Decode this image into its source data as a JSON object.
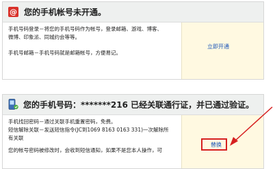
{
  "panel_activate": {
    "title": "您的手机帐号未开通。",
    "lines": [
      "手机号码登录－将您的手机号码作为帐号，登录邮箱、游戏、博客、",
      "微博、印象派、同城约会等等。",
      "手机号邮箱－手机号码就是邮箱帐号，方便易记。"
    ],
    "action_label": "立即开通"
  },
  "panel_bound": {
    "title": "您的手机号码：*******216  已经关联通行证，并已通过验证。",
    "lines": [
      "手机找回密码－通过关联手机重置密码，免费。",
      "短信解除关联－发送短信指令(JC到1069 8163 0163 331)一次解除所",
      "有关联",
      "您的帐号密码被修改时，会收到短信通知，如果不是您本人操作，可"
    ],
    "action_label": "替换"
  },
  "colors": {
    "accent_red": "#d9322b",
    "link_blue": "#1c56b8",
    "action_bg": "#fff9e1",
    "highlight_red": "#d62020"
  }
}
